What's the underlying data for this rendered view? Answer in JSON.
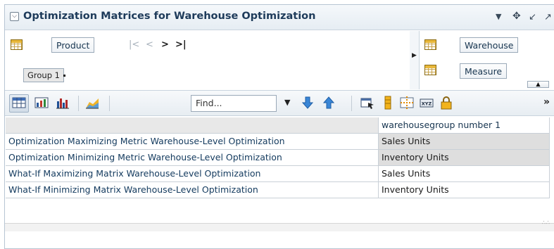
{
  "header": {
    "collapse_glyph": "⌵",
    "title": "Optimization Matrices for Warehouse Optimization",
    "icons": [
      "chevron-down-icon",
      "move-icon",
      "minimize-icon",
      "maximize-icon"
    ]
  },
  "pivot": {
    "row_dimension": "Product",
    "row_member": "Group 1",
    "column_dimensions": [
      "Warehouse",
      "Measure"
    ]
  },
  "toolbar": {
    "find_placeholder": "Find...",
    "icons": [
      "table-view-icon",
      "chart-table-icon",
      "bar-chart-icon",
      "area-chart-icon",
      "find-down-arrow-icon",
      "find-up-arrow-icon",
      "export-icon",
      "column-icon",
      "split-icon",
      "xyz-icon",
      "lock-icon",
      "overflow-icon"
    ],
    "overflow": "»"
  },
  "table": {
    "column_header": "warehousegroup number 1",
    "rows": [
      {
        "label": "Optimization Maximizing Metric Warehouse-Level Optimization",
        "value": "Sales Units",
        "shaded": true
      },
      {
        "label": "Optimization Minimizing Metric Warehouse-Level Optimization",
        "value": "Inventory Units",
        "shaded": true
      },
      {
        "label": "What-If Maximizing Matrix Warehouse-Level Optimization",
        "value": "Sales Units",
        "shaded": false
      },
      {
        "label": "What-If Minimizing Matrix Warehouse-Level Optimization",
        "value": "Inventory Units",
        "shaded": false
      }
    ]
  },
  "colors": {
    "title": "#1e3b5a",
    "row_label": "#133a5e",
    "shaded_cell": "#dedede",
    "find_arrow": "#3a86d6"
  }
}
